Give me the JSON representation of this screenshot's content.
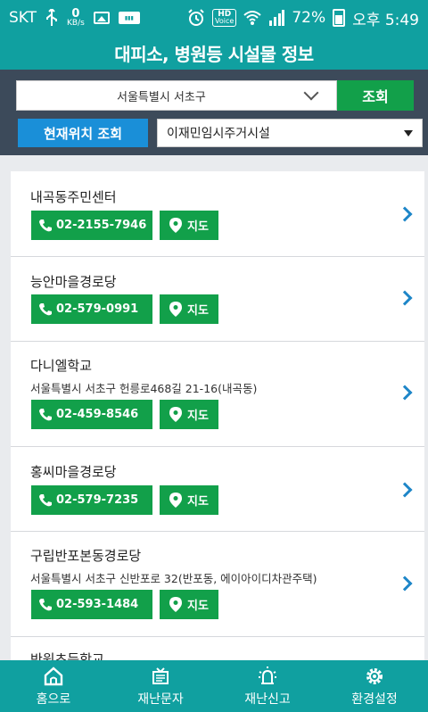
{
  "status": {
    "carrier": "SKT",
    "net_speed": "0",
    "net_unit": "KB/s",
    "hd_top": "HD",
    "hd_bottom": "Voice",
    "battery": "72%",
    "time": "오후 5:49"
  },
  "header": {
    "title": "대피소, 병원등 시설물 정보"
  },
  "search": {
    "region": "서울특별시 서초구",
    "search_label": "조회",
    "locate_label": "현재위치 조회",
    "facility_type": "이재민임시주거시설"
  },
  "facilities": [
    {
      "name": "내곡동주민센터",
      "address": "",
      "phone": "02-2155-7946",
      "map_label": "지도"
    },
    {
      "name": "능안마을경로당",
      "address": "",
      "phone": "02-579-0991",
      "map_label": "지도"
    },
    {
      "name": "다니엘학교",
      "address": "서울특별시 서초구 헌릉로468길 21-16(내곡동)",
      "phone": "02-459-8546",
      "map_label": "지도"
    },
    {
      "name": "홍씨마을경로당",
      "address": "",
      "phone": "02-579-7235",
      "map_label": "지도"
    },
    {
      "name": "구립반포본동경로당",
      "address": "서울특별시 서초구 신반포로 32(반포동, 에이아이디차관주택)",
      "phone": "02-593-1484",
      "map_label": "지도"
    },
    {
      "name": "반원초등학교",
      "address": "",
      "phone": "",
      "map_label": ""
    }
  ],
  "nav": {
    "home": "홈으로",
    "disaster_msg": "재난문자",
    "report": "재난신고",
    "settings": "환경설정"
  },
  "colors": {
    "primary": "#10a0a0",
    "green": "#12a04a",
    "blue": "#1a8fd8",
    "dark": "#3c4a5a",
    "arrow": "#1e86c8"
  }
}
